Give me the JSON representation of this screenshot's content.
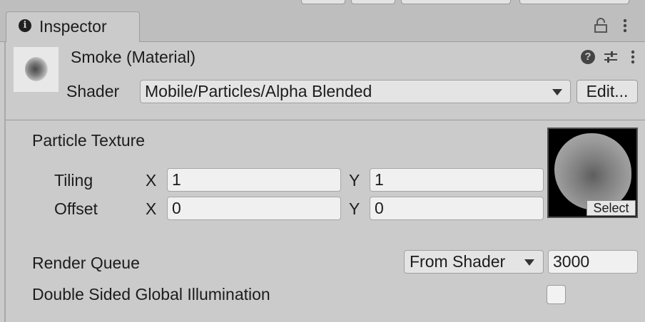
{
  "tab": {
    "title": "Inspector",
    "info_icon": "info-icon",
    "lock_icon": "lock-icon",
    "menu_icon": "kebab-menu-icon"
  },
  "material": {
    "name": "Smoke (Material)",
    "help_icon": "help-icon",
    "settings_icon": "sliders-icon",
    "menu_icon": "kebab-menu-icon",
    "shader_label": "Shader",
    "shader_value": "Mobile/Particles/Alpha Blended",
    "edit_button": "Edit..."
  },
  "properties": {
    "particle_texture_label": "Particle Texture",
    "tiling_label": "Tiling",
    "offset_label": "Offset",
    "tiling": {
      "x_label": "X",
      "x": "1",
      "y_label": "Y",
      "y": "1"
    },
    "offset": {
      "x_label": "X",
      "x": "0",
      "y_label": "Y",
      "y": "0"
    },
    "texture_select": "Select",
    "render_queue_label": "Render Queue",
    "render_queue_mode": "From Shader",
    "render_queue_value": "3000",
    "double_sided_gi_label": "Double Sided Global Illumination",
    "double_sided_gi_checked": false
  },
  "colors": {
    "panel_bg": "#cbcbcb",
    "tabbar_bg": "#bebebe",
    "field_bg": "#f0f0f0",
    "text": "#1c1c1c"
  }
}
